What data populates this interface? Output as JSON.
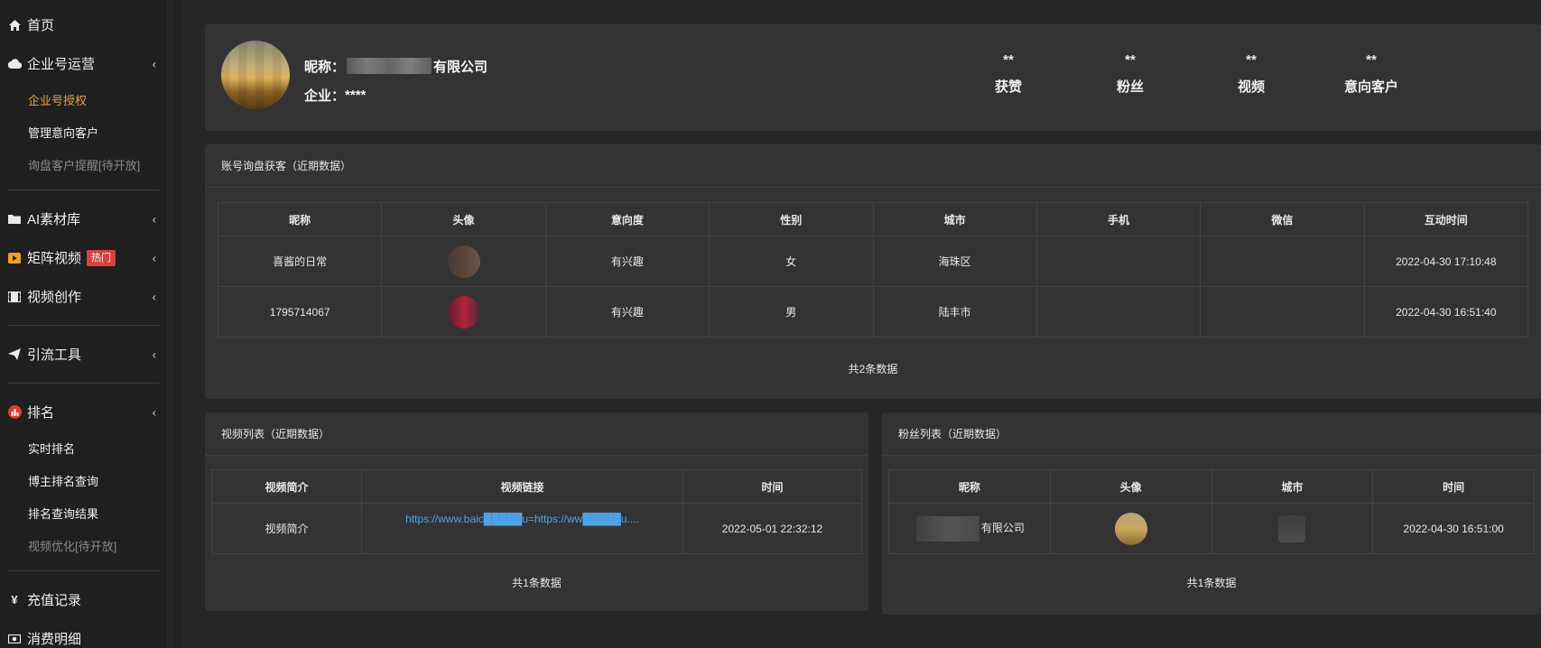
{
  "sidebar": {
    "home": {
      "label": "首页",
      "icon": "home-icon"
    },
    "enterprise": {
      "label": "企业号运营",
      "icon": "cloud-icon"
    },
    "enterprise_subs": [
      {
        "label": "企业号授权",
        "state": "active"
      },
      {
        "label": "管理意向客户",
        "state": "normal"
      },
      {
        "label": "询盘客户提醒[待开放]",
        "state": "disabled"
      }
    ],
    "ai_library": {
      "label": "AI素材库",
      "icon": "folder-icon"
    },
    "matrix_video": {
      "label": "矩阵视频",
      "badge": "热门",
      "icon": "video-tag-icon"
    },
    "video_create": {
      "label": "视频创作",
      "icon": "film-icon"
    },
    "traffic_tools": {
      "label": "引流工具",
      "icon": "paper-plane-icon"
    },
    "ranking": {
      "label": "排名",
      "icon": "ranking-icon"
    },
    "ranking_subs": [
      {
        "label": "实时排名",
        "state": "normal"
      },
      {
        "label": "博主排名查询",
        "state": "normal"
      },
      {
        "label": "排名查询结果",
        "state": "normal"
      },
      {
        "label": "视频优化[待开放]",
        "state": "disabled"
      }
    ],
    "recharge": {
      "label": "充值记录",
      "icon": "yen-icon"
    },
    "consumption": {
      "label": "消费明细",
      "icon": "money-icon"
    }
  },
  "profile": {
    "nickname_label": "昵称：",
    "nickname_suffix": "有限公司",
    "company_label": "企业：",
    "company_value": "****",
    "stats": [
      {
        "value": "**",
        "label": "获赞"
      },
      {
        "value": "**",
        "label": "粉丝"
      },
      {
        "value": "**",
        "label": "视频"
      },
      {
        "value": "**",
        "label": "意向客户"
      }
    ]
  },
  "inquiry": {
    "title": "账号询盘获客（近期数据）",
    "columns": [
      "昵称",
      "头像",
      "意向度",
      "性别",
      "城市",
      "手机",
      "微信",
      "互动时间"
    ],
    "rows": [
      {
        "nickname": "喜酱的日常",
        "intent": "有兴趣",
        "gender": "女",
        "city": "海珠区",
        "phone": "",
        "wechat": "",
        "time": "2022-04-30 17:10:48"
      },
      {
        "nickname": "1795714067",
        "intent": "有兴趣",
        "gender": "男",
        "city": "陆丰市",
        "phone": "",
        "wechat": "",
        "time": "2022-04-30 16:51:40"
      }
    ],
    "count_text": "共2条数据"
  },
  "video_list": {
    "title": "视频列表（近期数据）",
    "columns": [
      "视频简介",
      "视频链接",
      "时间"
    ],
    "rows": [
      {
        "intro": "视频简介",
        "link": "https://www.baic█████u=https://ww█████u....",
        "time": "2022-05-01 22:32:12"
      }
    ],
    "count_text": "共1条数据"
  },
  "fans_list": {
    "title": "粉丝列表（近期数据）",
    "columns": [
      "昵称",
      "头像",
      "城市",
      "时间"
    ],
    "rows": [
      {
        "nickname_suffix": "有限公司",
        "time": "2022-04-30 16:51:00"
      }
    ],
    "count_text": "共1条数据"
  }
}
